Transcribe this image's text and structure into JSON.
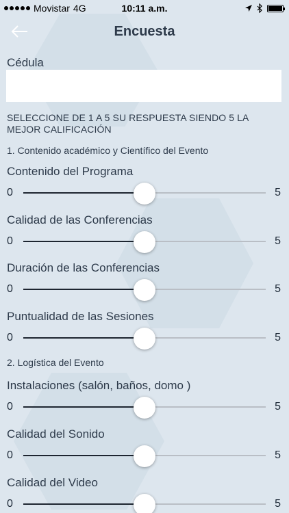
{
  "status_bar": {
    "carrier": "Movistar",
    "network": "4G",
    "time": "10:11 a.m."
  },
  "nav": {
    "title": "Encuesta"
  },
  "form": {
    "cedula_label": "Cédula",
    "cedula_value": "",
    "instructions": "SELECCIONE DE 1 A 5 SU RESPUESTA SIENDO 5 LA MEJOR CALIFICACIÓN"
  },
  "sections": [
    {
      "title": "1. Contenido académico y Científico del Evento",
      "questions": [
        {
          "label": "Contenido del Programa",
          "min": "0",
          "max": "5",
          "fraction": 0.5
        },
        {
          "label": "Calidad de las Conferencias",
          "min": "0",
          "max": "5",
          "fraction": 0.5
        },
        {
          "label": "Duración de las Conferencias",
          "min": "0",
          "max": "5",
          "fraction": 0.5
        },
        {
          "label": "Puntualidad de las Sesiones",
          "min": "0",
          "max": "5",
          "fraction": 0.5
        }
      ]
    },
    {
      "title": "2. Logística del Evento",
      "questions": [
        {
          "label": "Instalaciones (salón, baños, domo )",
          "min": "0",
          "max": "5",
          "fraction": 0.5
        },
        {
          "label": "Calidad del Sonido",
          "min": "0",
          "max": "5",
          "fraction": 0.5
        },
        {
          "label": "Calidad del Video",
          "min": "0",
          "max": "5",
          "fraction": 0.5
        }
      ]
    }
  ]
}
